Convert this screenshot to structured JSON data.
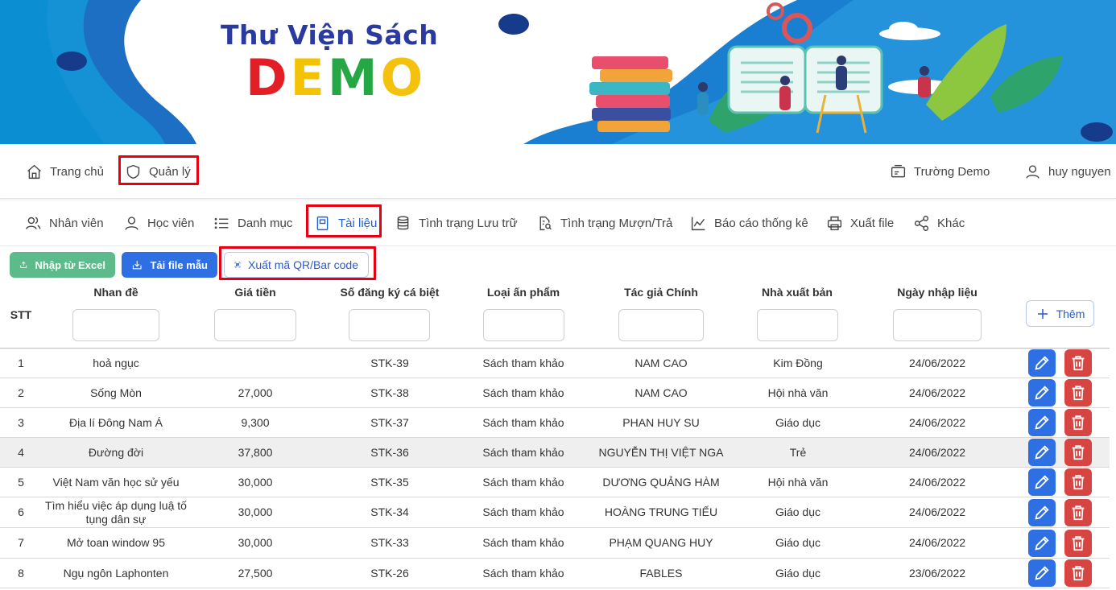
{
  "banner": {
    "title": "Thư Viện Sách",
    "demo_letters": [
      {
        "char": "D",
        "color": "#e31e24"
      },
      {
        "char": "E",
        "color": "#f3c300"
      },
      {
        "char": "M",
        "color": "#26a745"
      },
      {
        "char": "O",
        "color": "#f4c20d"
      }
    ]
  },
  "topnav": {
    "home": "Trang chủ",
    "manage": "Quản lý",
    "school": "Trường Demo",
    "user": "huy nguyen"
  },
  "subnav": {
    "items": [
      {
        "label": "Nhân viên",
        "icon": "users-icon"
      },
      {
        "label": "Học viên",
        "icon": "user-icon"
      },
      {
        "label": "Danh mục",
        "icon": "list-icon"
      },
      {
        "label": "Tài liệu",
        "icon": "document-icon"
      },
      {
        "label": "Tình trạng Lưu trữ",
        "icon": "database-icon"
      },
      {
        "label": "Tình trạng Mượn/Trả",
        "icon": "file-search-icon"
      },
      {
        "label": "Báo cáo thống kê",
        "icon": "chart-icon"
      },
      {
        "label": "Xuất file",
        "icon": "printer-icon"
      },
      {
        "label": "Khác",
        "icon": "share-icon"
      }
    ]
  },
  "actions": {
    "import_excel": "Nhập từ Excel",
    "download_template": "Tải file mẫu",
    "export_qr": "Xuất mã QR/Bar code"
  },
  "table": {
    "headers": {
      "stt": "STT",
      "title": "Nhan đề",
      "price": "Giá tiền",
      "reg_no": "Số đăng ký cá biệt",
      "type": "Loại ấn phẩm",
      "author": "Tác giả Chính",
      "publisher": "Nhà xuất bản",
      "date": "Ngày nhập liệu"
    },
    "add_label": "Thêm",
    "rows": [
      {
        "stt": "1",
        "title": "hoả ngục",
        "price": "",
        "reg_no": "STK-39",
        "type": "Sách tham khảo",
        "author": "NAM CAO",
        "publisher": "Kim Đồng",
        "date": "24/06/2022"
      },
      {
        "stt": "2",
        "title": "Sống Mòn",
        "price": "27,000",
        "reg_no": "STK-38",
        "type": "Sách tham khảo",
        "author": "NAM CAO",
        "publisher": "Hội nhà văn",
        "date": "24/06/2022"
      },
      {
        "stt": "3",
        "title": "Địa lí Đông Nam Á",
        "price": "9,300",
        "reg_no": "STK-37",
        "type": "Sách tham khảo",
        "author": "PHAN HUY SU",
        "publisher": "Giáo dục",
        "date": "24/06/2022"
      },
      {
        "stt": "4",
        "title": "Đường đời",
        "price": "37,800",
        "reg_no": "STK-36",
        "type": "Sách tham khảo",
        "author": "NGUYỄN THỊ VIỆT NGA",
        "publisher": "Trẻ",
        "date": "24/06/2022"
      },
      {
        "stt": "5",
        "title": "Việt Nam văn học sử yếu",
        "price": "30,000",
        "reg_no": "STK-35",
        "type": "Sách tham khảo",
        "author": "DƯƠNG QUẢNG HÀM",
        "publisher": "Hội nhà văn",
        "date": "24/06/2022"
      },
      {
        "stt": "6",
        "title": "Tìm hiểu việc áp dụng luậ tố tụng dân sự",
        "price": "30,000",
        "reg_no": "STK-34",
        "type": "Sách tham khảo",
        "author": "HOÀNG TRUNG TIẾU",
        "publisher": "Giáo dục",
        "date": "24/06/2022"
      },
      {
        "stt": "7",
        "title": "Mở toan window 95",
        "price": "30,000",
        "reg_no": "STK-33",
        "type": "Sách tham khảo",
        "author": "PHẠM QUANG HUY",
        "publisher": "Giáo dục",
        "date": "24/06/2022"
      },
      {
        "stt": "8",
        "title": "Ngụ ngôn Laphonten",
        "price": "27,500",
        "reg_no": "STK-26",
        "type": "Sách tham khảo",
        "author": "FABLES",
        "publisher": "Giáo dục",
        "date": "23/06/2022"
      }
    ]
  },
  "colors": {
    "accent_blue": "#2f6fe4",
    "import_green": "#5dba8a",
    "delete_red": "#d64541",
    "highlight_red": "#e60012"
  }
}
